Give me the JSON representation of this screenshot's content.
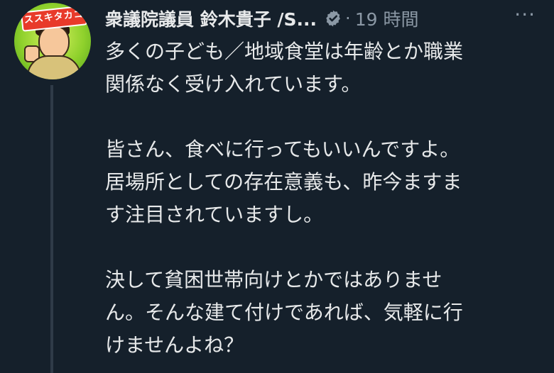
{
  "avatar": {
    "label": "ススキタカコ",
    "accent": "#8fd12c",
    "icon": "cartoon-portrait"
  },
  "author": {
    "name": "衆議院議員 鈴木貴子 /S...",
    "verified_color": "#8b98a5"
  },
  "meta": {
    "separator": "·",
    "time": "19 時間"
  },
  "more_icon": "more-icon",
  "body": {
    "lines": [
      "多くの子ども／地域食堂は年齢とか職業",
      "関係なく受け入れています。",
      "",
      "皆さん、食べに行ってもいいんですよ。",
      "居場所としての存在意義も、昨今ますま",
      "す注目されていますし。",
      "",
      "決して貧困世帯向けとかではありませ",
      "ん。そんな建て付けであれば、気軽に行",
      "けませんよね？"
    ]
  },
  "colors": {
    "background": "#15202b",
    "text": "#e7e9ea",
    "muted": "#8b98a5"
  }
}
